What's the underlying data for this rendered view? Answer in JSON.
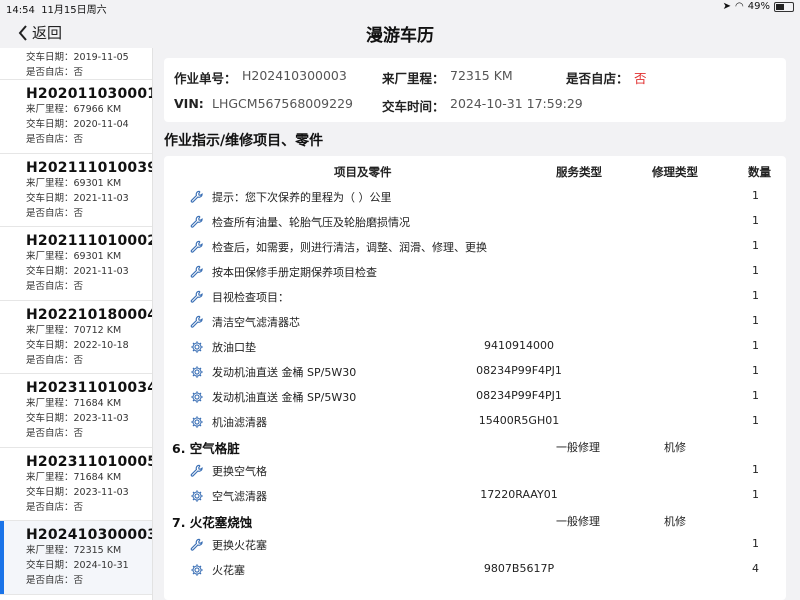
{
  "status_bar": {
    "time": "14:54",
    "date": "11月15日周六",
    "battery": "49%",
    "battery_level": 0.49
  },
  "nav": {
    "back_label": "返回",
    "title": "漫游车历"
  },
  "sidebar": {
    "partial_top": {
      "delivery": "交车日期：2019-11-05",
      "own_store": "是否自店：否"
    },
    "items": [
      {
        "no": "H202011030001",
        "mileage": "来厂里程：67966 KM",
        "delivery": "交车日期：2020-11-04",
        "own_store": "是否自店：否"
      },
      {
        "no": "H202111010039",
        "mileage": "来厂里程：69301 KM",
        "delivery": "交车日期：2021-11-03",
        "own_store": "是否自店：否"
      },
      {
        "no": "H202111010002",
        "mileage": "来厂里程：69301 KM",
        "delivery": "交车日期：2021-11-03",
        "own_store": "是否自店：否"
      },
      {
        "no": "H202210180004",
        "mileage": "来厂里程：70712 KM",
        "delivery": "交车日期：2022-10-18",
        "own_store": "是否自店：否"
      },
      {
        "no": "H202311010034",
        "mileage": "来厂里程：71684 KM",
        "delivery": "交车日期：2023-11-03",
        "own_store": "是否自店：否"
      },
      {
        "no": "H202311010005",
        "mileage": "来厂里程：71684 KM",
        "delivery": "交车日期：2023-11-03",
        "own_store": "是否自店：否"
      },
      {
        "no": "H202410300003",
        "mileage": "来厂里程：72315 KM",
        "delivery": "交车日期：2024-10-31",
        "own_store": "是否自店：否"
      }
    ]
  },
  "info": {
    "order_label": "作业单号：",
    "order_value": "H202410300003",
    "mileage_label": "来厂里程：",
    "mileage_value": "72315 KM",
    "own_store_label": "是否自店：",
    "own_store_value": "否",
    "vin_label": "VIN:",
    "vin_value": "LHGCM567568009229",
    "delivery_label": "交车时间：",
    "delivery_value": "2024-10-31 17:59:29"
  },
  "section_title": "作业指示/维修项目、零件",
  "table": {
    "headers": {
      "item": "项目及零件",
      "service": "服务类型",
      "repair": "修理类型",
      "qty": "数量"
    },
    "rows": [
      {
        "kind": "row",
        "icon": "wrench-icon",
        "name": "提示：您下次保养的里程为（    ）公里",
        "part": "",
        "qty": "1"
      },
      {
        "kind": "row",
        "icon": "wrench-icon",
        "name": "检查所有油量、轮胎气压及轮胎磨损情况",
        "part": "",
        "qty": "1"
      },
      {
        "kind": "row",
        "icon": "wrench-icon",
        "name": "检查后，如需要，则进行清洁，调整、润滑、修理、更换",
        "part": "",
        "qty": "1"
      },
      {
        "kind": "row",
        "icon": "wrench-icon",
        "name": "按本田保修手册定期保养项目检查",
        "part": "",
        "qty": "1"
      },
      {
        "kind": "row",
        "icon": "wrench-icon",
        "name": "目视检查项目：",
        "part": "",
        "qty": "1"
      },
      {
        "kind": "row",
        "icon": "wrench-icon",
        "name": "清洁空气滤清器芯",
        "part": "",
        "qty": "1"
      },
      {
        "kind": "row",
        "icon": "gear-icon",
        "name": "放油口垫",
        "part": "9410914000",
        "qty": "1"
      },
      {
        "kind": "row",
        "icon": "gear-icon",
        "name": "发动机油直送 金桶 SP/5W30",
        "part": "08234P99F4PJ1",
        "qty": "1"
      },
      {
        "kind": "row",
        "icon": "gear-icon",
        "name": "发动机油直送 金桶 SP/5W30",
        "part": "08234P99F4PJ1",
        "qty": "1"
      },
      {
        "kind": "row",
        "icon": "gear-icon",
        "name": "机油滤清器",
        "part": "15400R5GH01",
        "qty": "1"
      },
      {
        "kind": "group",
        "name": "6. 空气格脏",
        "service": "一般修理",
        "repair": "机修"
      },
      {
        "kind": "row",
        "icon": "wrench-icon",
        "name": "更换空气格",
        "part": "",
        "qty": "1"
      },
      {
        "kind": "row",
        "icon": "gear-icon",
        "name": "空气滤清器",
        "part": "17220RAAY01",
        "qty": "1"
      },
      {
        "kind": "group",
        "name": "7. 火花塞烧蚀",
        "service": "一般修理",
        "repair": "机修"
      },
      {
        "kind": "row",
        "icon": "wrench-icon",
        "name": "更换火花塞",
        "part": "",
        "qty": "1"
      },
      {
        "kind": "row",
        "icon": "gear-icon",
        "name": "火花塞",
        "part": "9807B5617P",
        "qty": "4"
      }
    ]
  }
}
